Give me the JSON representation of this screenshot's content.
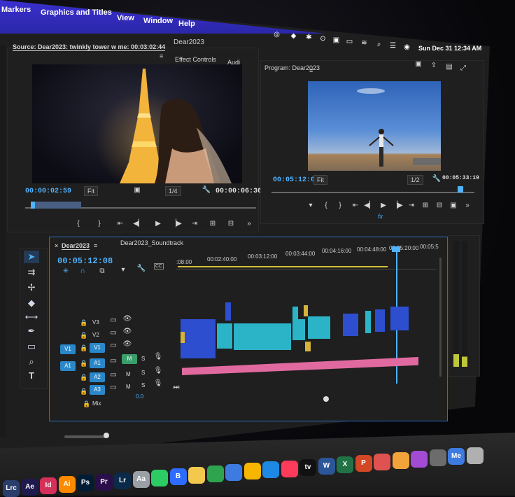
{
  "menubar": {
    "items": [
      "Markers",
      "Graphics and Titles",
      "View",
      "Window",
      "Help"
    ],
    "clock": "Sun Dec 31  12:34 AM",
    "bg_color": "#2f2bc0"
  },
  "window": {
    "title": "Dear2023"
  },
  "source_panel": {
    "tab_label": "Source: Dear2023: twinkly tower w me: 00:03:02:44",
    "tab_menu": "≡",
    "effect_controls": "Effect Controls",
    "audio_tab": "Audi",
    "timecode": "00:00:02:59",
    "fit": "Fit",
    "quality": "1/4",
    "duration": "00:00:06:36"
  },
  "program_panel": {
    "tab_label": "Program: Dear2023",
    "tab_menu": "≡",
    "timecode": "00:05:12:08",
    "fit": "Fit",
    "quality": "1/2",
    "duration": "00:05:33:19",
    "fx": "fx"
  },
  "timeline": {
    "tabs": [
      "Dear2023",
      "Dear2023_Soundtrack"
    ],
    "tab_menu": "≡",
    "timecode": "00:05:12:08",
    "ruler": [
      ":08:00",
      "00:02:40:00",
      "00:03:12:00",
      "00:03:44:00",
      "00:04:16:00",
      "00:04:48:00",
      "00:05:20:00",
      "00:05:5"
    ],
    "video_tracks": [
      "V3",
      "V2",
      "V1"
    ],
    "audio_tracks": [
      "A1",
      "A2",
      "A3"
    ],
    "source_v1": "V1",
    "source_a1": "A1",
    "mute": "M",
    "solo": "S",
    "mix_label": "Mix",
    "mix_value": "0.0",
    "accent": "#2a87c9",
    "clip_colors": {
      "video": "#2d4fcf",
      "cyan": "#2bb3c7",
      "yellow": "#d6b43a",
      "audio": "#e06aa0"
    }
  },
  "tools": [
    "selection-tool",
    "track-select-tool",
    "ripple-edit-tool",
    "razor-tool",
    "slip-tool",
    "pen-tool",
    "rectangle-tool",
    "hand-tool",
    "type-tool"
  ],
  "dock": {
    "apps": [
      "Lrc",
      "Ae",
      "Id",
      "Ai",
      "Ps",
      "Pr",
      "Lr",
      "Aa",
      "",
      "B",
      "",
      "",
      "",
      "",
      "",
      "",
      "tv",
      "W",
      "X",
      "P",
      "",
      "",
      "",
      "",
      "Me",
      ""
    ]
  }
}
